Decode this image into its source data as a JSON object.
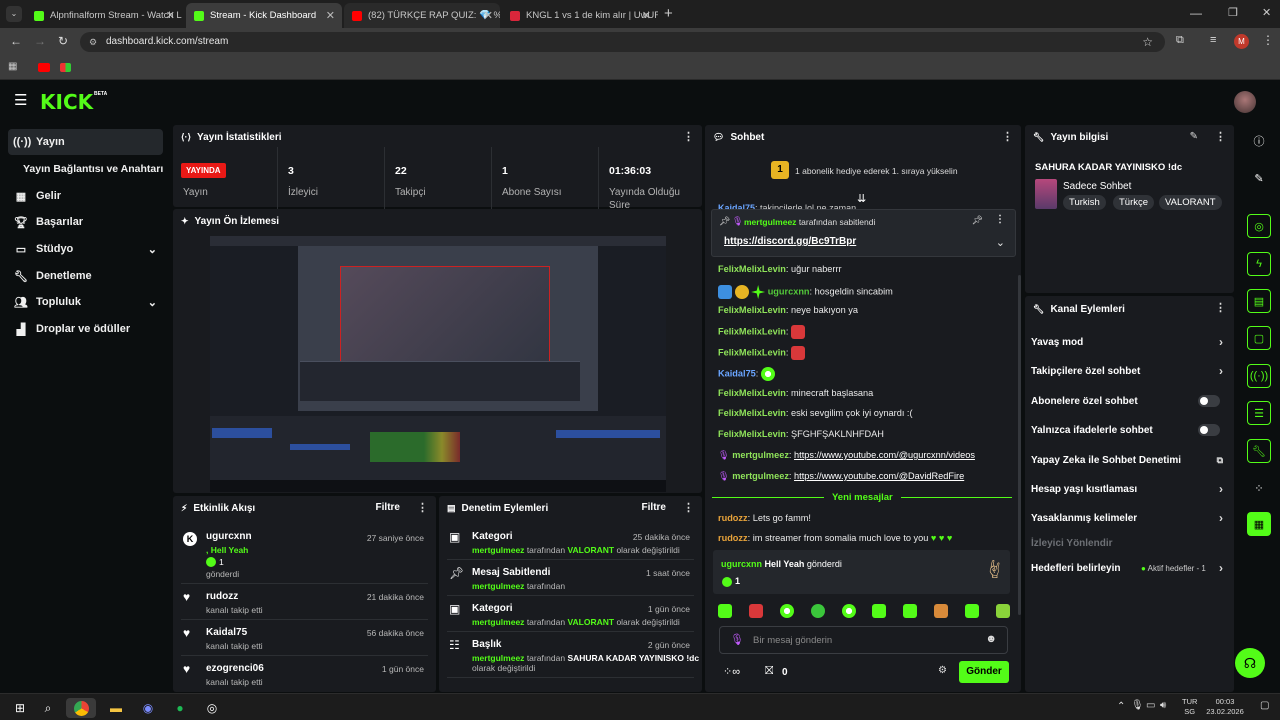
{
  "browser": {
    "tabs": [
      {
        "title": "Alpnfinalform Stream - Watch L",
        "active": false
      },
      {
        "title": "Stream - Kick Dashboard",
        "active": true
      },
      {
        "title": "(82) TÜRKÇE RAP QUIZ: 💎 %9",
        "active": false
      },
      {
        "title": "KNGL 1 vs 1 de kim alır | UwUF",
        "active": false
      }
    ],
    "url": "dashboard.kick.com/stream",
    "profile_initial": "M"
  },
  "app": {
    "logo": "KICK",
    "logo_badge": "BETA"
  },
  "sidebar": {
    "items": [
      {
        "label": "Yayın",
        "icon": "broadcast-icon"
      },
      {
        "label": "Yayın Bağlantısı ve Anahtarı",
        "icon": ""
      },
      {
        "label": "Gelir",
        "icon": "revenue-icon"
      },
      {
        "label": "Başarılar",
        "icon": "trophy-icon"
      },
      {
        "label": "Stüdyo",
        "icon": "studio-icon"
      },
      {
        "label": "Denetleme",
        "icon": "wrench-icon"
      },
      {
        "label": "Topluluk",
        "icon": "community-icon"
      },
      {
        "label": "Droplar ve ödüller",
        "icon": "drops-icon"
      }
    ]
  },
  "stats": {
    "title": "Yayın İstatistikleri",
    "live_badge": "YAYINDA",
    "live_label": "Yayın",
    "items": [
      {
        "value": "3",
        "label": "İzleyici"
      },
      {
        "value": "22",
        "label": "Takipçi"
      },
      {
        "value": "1",
        "label": "Abone Sayısı"
      },
      {
        "value": "01:36:03",
        "label": "Yayında Olduğu Süre"
      }
    ]
  },
  "preview": {
    "title": "Yayın Ön İzlemesi"
  },
  "activity": {
    "title": "Etkinlik Akışı",
    "filter": "Filtre",
    "items": [
      {
        "name": "ugurcxnn",
        "detail": ", Hell Yeah",
        "count": "1",
        "sub": "gönderdi",
        "time": "27 saniye önce",
        "icon": "kick-icon"
      },
      {
        "name": "rudozz",
        "sub": "kanalı takip etti",
        "time": "21 dakika önce",
        "icon": "heart-icon"
      },
      {
        "name": "Kaidal75",
        "sub": "kanalı takip etti",
        "time": "56 dakika önce",
        "icon": "heart-icon"
      },
      {
        "name": "ezogrenci06",
        "sub": "kanalı takip etti",
        "time": "1 gün önce",
        "icon": "heart-icon"
      }
    ]
  },
  "moderation": {
    "title": "Denetim Eylemleri",
    "filter": "Filtre",
    "items": [
      {
        "title": "Kategori",
        "time": "25 dakika önce",
        "line1_user": "mertgulmeez",
        "line1_mid": "tarafından",
        "line1_val": "VALORANT",
        "line1_end": "olarak değiştirildi",
        "line2": ""
      },
      {
        "title": "Mesaj Sabitlendi",
        "time": "1 saat önce",
        "line1_user": "mertgulmeez",
        "line1_mid": "tarafından",
        "line1_val": "",
        "line1_end": "",
        "line2": ""
      },
      {
        "title": "Kategori",
        "time": "1 gün önce",
        "line1_user": "mertgulmeez",
        "line1_mid": "tarafından",
        "line1_val": "VALORANT",
        "line1_end": "olarak değiştirildi",
        "line2": ""
      },
      {
        "title": "Başlık",
        "time": "2 gün önce",
        "line1_user": "mertgulmeez",
        "line1_mid": "tarafından",
        "line1_val": "SAHURA KADAR YAYINISKO !dc",
        "line1_end": "",
        "line2": "olarak değiştirildi"
      }
    ]
  },
  "chat": {
    "title": "Sohbet",
    "gift_banner": "1 abonelik hediye ederek 1. sıraya yükselin",
    "gift_rank": "1",
    "partial_line_user": "Kaidal75",
    "partial_line_text": ": takipçilerle lol ne zaman",
    "pinned_by": "mertgulmeez",
    "pinned_suffix": "tarafından sabitlendi",
    "pinned_link": "https://discord.gg/Bc9TrBpr",
    "messages": [
      {
        "user": "FelixMelixLevin",
        "text": "uğur naberrr"
      },
      {
        "user": "ugurcxnn",
        "text": "hosgeldin sincabim"
      },
      {
        "user": "FelixMelixLevin",
        "text": "neye bakıyon ya"
      },
      {
        "user": "FelixMelixLevin",
        "text": ""
      },
      {
        "user": "FelixMelixLevin",
        "text": ""
      },
      {
        "user": "Kaidal75",
        "text": ""
      },
      {
        "user": "FelixMelixLevin",
        "text": "minecraft başlasana"
      },
      {
        "user": "FelixMelixLevin",
        "text": "eski sevgilim çok iyi oynardı :("
      },
      {
        "user": "FelixMelixLevin",
        "text": "ŞFGHFŞAKLNHFDAH"
      },
      {
        "user": "mertgulmeez",
        "text": "https://www.youtube.com/@ugurcxnn/videos"
      },
      {
        "user": "mertgulmeez",
        "text": "https://www.youtube.com/@DavidRedFire"
      }
    ],
    "new_messages": "Yeni mesajlar",
    "new": [
      {
        "user": "rudozz",
        "text": "Lets go famm!"
      },
      {
        "user": "rudozz",
        "text": "im streamer from somalia much love to you"
      }
    ],
    "kick_user": "ugurcxnn",
    "kick_item": "Hell Yeah",
    "kick_verb": "gönderdi",
    "kick_count": "1",
    "input_placeholder": "Bir mesaj gönderin",
    "points": "0",
    "send": "Gönder"
  },
  "stream_info": {
    "title": "Yayın bilgisi",
    "stream_title": "SAHURA KADAR YAYINISKO !dc",
    "category": "Sadece Sohbet",
    "tags": [
      "Turkish",
      "Türkçe",
      "VALORANT"
    ]
  },
  "channel_actions": {
    "title": "Kanal Eylemleri",
    "items": [
      {
        "label": "Yavaş mod",
        "control": "chevron"
      },
      {
        "label": "Takipçilere özel sohbet",
        "control": "chevron"
      },
      {
        "label": "Abonelere özel sohbet",
        "control": "toggle"
      },
      {
        "label": "Yalnızca ifadelerle sohbet",
        "control": "toggle"
      },
      {
        "label": "Yapay Zeka ile Sohbet Denetimi",
        "control": "external"
      },
      {
        "label": "Hesap yaşı kısıtlaması",
        "control": "chevron"
      },
      {
        "label": "Yasaklanmış kelimeler",
        "control": "chevron"
      }
    ],
    "viewer_redirect": "İzleyici Yönlendir",
    "goals_label": "Hedefleri belirleyin",
    "goals_status": "Aktif hedefler - 1"
  },
  "taskbar": {
    "lang_top": "TUR",
    "lang_bottom": "SG",
    "time": "00:03",
    "date": "23.02.2026"
  },
  "colors": {
    "kick_green": "#53fc18",
    "live_red": "#e91916",
    "panel": "#191b1f"
  }
}
